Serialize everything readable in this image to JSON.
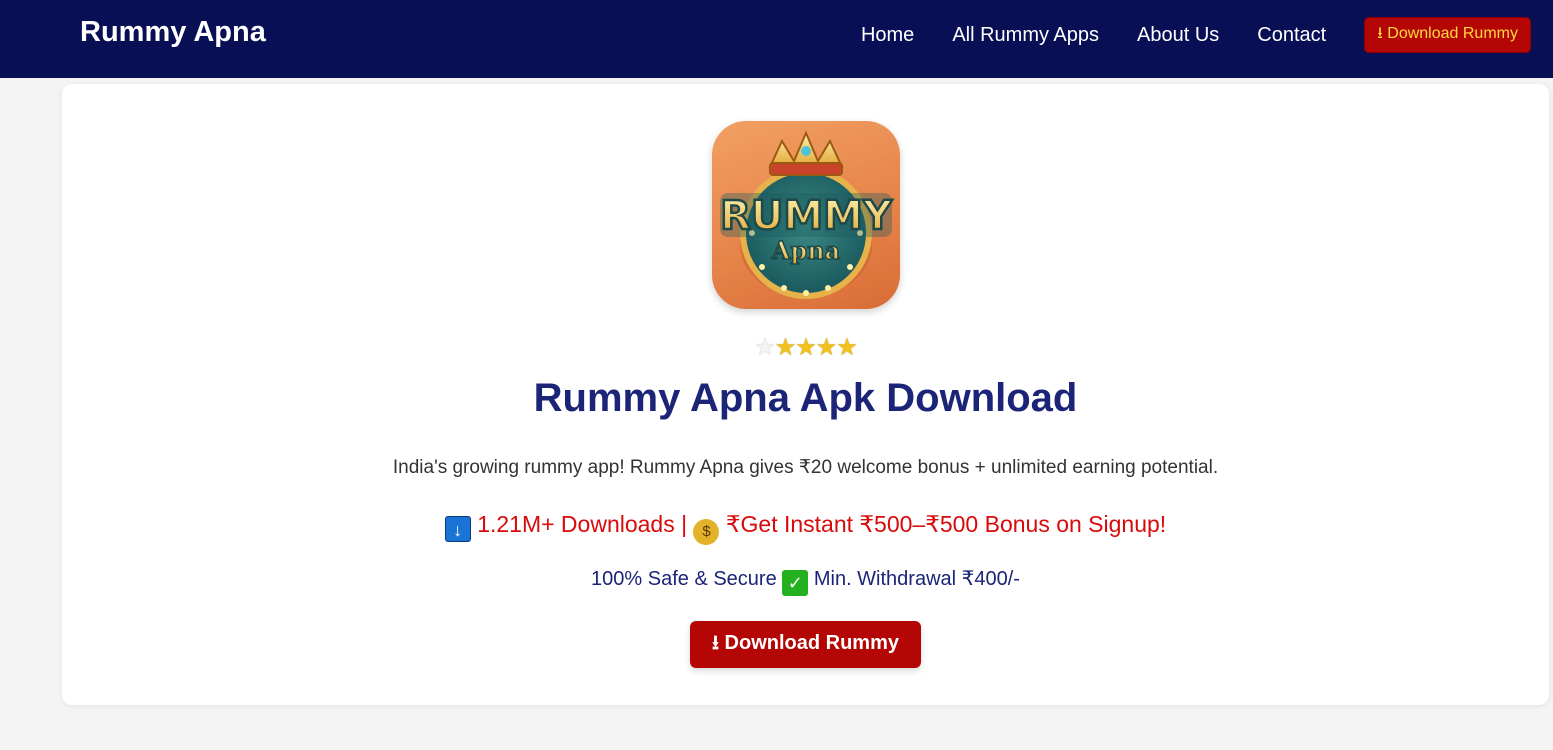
{
  "nav": {
    "brand": "Rummy Apna",
    "links": [
      "Home",
      "All Rummy Apps",
      "About Us",
      "Contact"
    ],
    "cta": "⭳ Download Rummy"
  },
  "hero": {
    "app_icon": {
      "alt": "Rummy Apna app icon",
      "logo_text_top": "RUMMY",
      "logo_text_bottom": "Apna"
    },
    "rating": {
      "value": 4.5,
      "max": 5
    },
    "title": "Rummy Apna Apk Download",
    "description": "India's growing rummy app! Rummy Apna gives ₹20 welcome bonus + unlimited earning potential.",
    "downloads_icon": "down-arrow-icon",
    "downloads_text": "1.21M+ Downloads |",
    "bonus_icon": "money-bag-icon",
    "bonus_text": "₹Get Instant ₹500–₹500 Bonus on Signup!",
    "safe_text": "100% Safe & Secure",
    "check_icon": "check-mark-icon",
    "withdraw_text": "Min. Withdrawal ₹400/-",
    "cta": "⭳ Download Rummy"
  },
  "colors": {
    "navbar": "#080f54",
    "cta_bg": "#b50606",
    "nav_cta_text": "#ffd93b",
    "title": "#1b2477",
    "promo": "#d80a0a"
  }
}
